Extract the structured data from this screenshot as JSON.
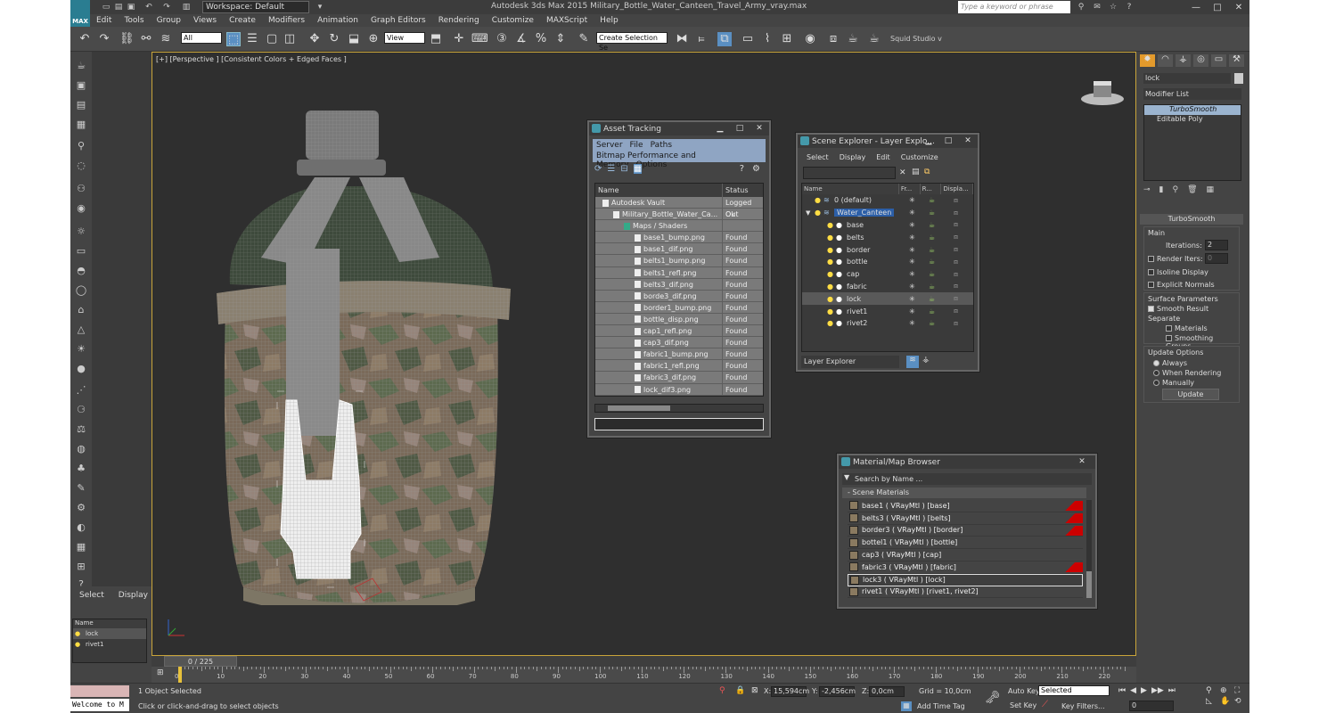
{
  "window": {
    "title": "Autodesk 3ds Max  2015      Military_Bottle_Water_Canteen_Travel_Army_vray.max",
    "workspace": "Workspace: Default",
    "search_placeholder": "Type a keyword or phrase",
    "logo": "MAX"
  },
  "menu": [
    "Edit",
    "Tools",
    "Group",
    "Views",
    "Create",
    "Modifiers",
    "Animation",
    "Graph Editors",
    "Rendering",
    "Customize",
    "MAXScript",
    "Help"
  ],
  "toolbar": {
    "filter": "All",
    "refcoord": "View",
    "selset": "Create Selection Se",
    "studio": "Squid Studio v"
  },
  "viewport": {
    "label": "[+] [Perspective ] [Consistent Colors + Edged Faces ]"
  },
  "asset_tracking": {
    "title": "Asset Tracking",
    "menu1": [
      "Server",
      "File",
      "Paths"
    ],
    "menu2": [
      "Bitmap Performance and Memory",
      "Options"
    ],
    "col_name": "Name",
    "col_status": "Status",
    "rows": [
      {
        "name": "Autodesk Vault",
        "status": "Logged Out",
        "indent": 0
      },
      {
        "name": "Military_Bottle_Water_Ca...",
        "status": "Ok",
        "indent": 1
      },
      {
        "name": "Maps / Shaders",
        "status": "",
        "indent": 2
      },
      {
        "name": "base1_bump.png",
        "status": "Found",
        "indent": 3
      },
      {
        "name": "base1_dif.png",
        "status": "Found",
        "indent": 3
      },
      {
        "name": "belts1_bump.png",
        "status": "Found",
        "indent": 3
      },
      {
        "name": "belts1_refl.png",
        "status": "Found",
        "indent": 3
      },
      {
        "name": "belts3_dif.png",
        "status": "Found",
        "indent": 3
      },
      {
        "name": "borde3_dif.png",
        "status": "Found",
        "indent": 3
      },
      {
        "name": "border1_bump.png",
        "status": "Found",
        "indent": 3
      },
      {
        "name": "bottle_disp.png",
        "status": "Found",
        "indent": 3
      },
      {
        "name": "cap1_refl.png",
        "status": "Found",
        "indent": 3
      },
      {
        "name": "cap3_dif.png",
        "status": "Found",
        "indent": 3
      },
      {
        "name": "fabric1_bump.png",
        "status": "Found",
        "indent": 3
      },
      {
        "name": "fabric1_refl.png",
        "status": "Found",
        "indent": 3
      },
      {
        "name": "fabric3_dif.png",
        "status": "Found",
        "indent": 3
      },
      {
        "name": "lock_dif3.png",
        "status": "Found",
        "indent": 3
      }
    ]
  },
  "scene_explorer": {
    "title": "Scene Explorer - Layer Explo...",
    "menu": [
      "Select",
      "Display",
      "Edit",
      "Customize"
    ],
    "cols": [
      "Name",
      "Fr...",
      "R...",
      "Displa..."
    ],
    "rows": [
      {
        "name": "0 (default)",
        "type": "layer"
      },
      {
        "name": "Water_Canteen",
        "type": "layer-selected"
      },
      {
        "name": "base",
        "type": "obj"
      },
      {
        "name": "belts",
        "type": "obj"
      },
      {
        "name": "border",
        "type": "obj"
      },
      {
        "name": "bottle",
        "type": "obj"
      },
      {
        "name": "cap",
        "type": "obj"
      },
      {
        "name": "fabric",
        "type": "obj"
      },
      {
        "name": "lock",
        "type": "obj-hl"
      },
      {
        "name": "rivet1",
        "type": "obj"
      },
      {
        "name": "rivet2",
        "type": "obj"
      }
    ],
    "footer": "Layer Explorer"
  },
  "material_browser": {
    "title": "Material/Map Browser",
    "search": "Search by Name ...",
    "group": "- Scene Materials",
    "rows": [
      {
        "name": "base1  ( VRayMtl )  [base]",
        "red": true
      },
      {
        "name": "belts3  ( VRayMtl )  [belts]",
        "red": true
      },
      {
        "name": "border3  ( VRayMtl )  [border]",
        "red": true
      },
      {
        "name": "bottel1  ( VRayMtl )  [bottle]",
        "red": false
      },
      {
        "name": "cap3  ( VRayMtl )  [cap]",
        "red": false
      },
      {
        "name": "fabric3  ( VRayMtl )  [fabric]",
        "red": true
      },
      {
        "name": "lock3  ( VRayMtl )  [lock]",
        "red": false,
        "sel": true
      },
      {
        "name": "rivet1  ( VRayMtl )  [rivet1, rivet2]",
        "red": false
      }
    ]
  },
  "command_panel": {
    "object_name": "lock",
    "modifier_list": "Modifier List",
    "stack": [
      "TurboSmooth",
      "Editable Poly"
    ],
    "rollout_title": "TurboSmooth",
    "main": "Main",
    "iterations_label": "Iterations:",
    "iterations": "2",
    "render_iters": "Render Iters:",
    "render_iters_val": "0",
    "isoline": "Isoline Display",
    "explicit": "Explicit Normals",
    "surface": "Surface Parameters",
    "smooth": "Smooth Result",
    "separate": "Separate",
    "materials": "Materials",
    "smoothing": "Smoothing Groups",
    "update_options": "Update Options",
    "always": "Always",
    "when_rendering": "When Rendering",
    "manually": "Manually",
    "update_btn": "Update"
  },
  "left_panel": {
    "tabs": [
      "Select",
      "Display"
    ],
    "name_col": "Name",
    "items": [
      "lock",
      "rivet1"
    ]
  },
  "timeline": {
    "frame": "0 / 225",
    "ticks": [
      "0",
      "10",
      "20",
      "30",
      "40",
      "50",
      "60",
      "70",
      "80",
      "90",
      "100",
      "110",
      "120",
      "130",
      "140",
      "150",
      "160",
      "170",
      "180",
      "190",
      "200",
      "210",
      "220"
    ]
  },
  "status": {
    "listener": "Welcome to M",
    "selected": "1 Object Selected",
    "prompt": "Click or click-and-drag to select objects",
    "x": "15,594cm",
    "y": "-2,456cm",
    "z": "0,0cm",
    "grid": "Grid = 10,0cm",
    "autokey": "Auto Key",
    "setkey": "Set Key",
    "keymode": "Selected",
    "keyfilters": "Key Filters...",
    "addtag": "Add Time Tag",
    "frame": "0",
    "x_lbl": "X:",
    "y_lbl": "Y:",
    "z_lbl": "Z:"
  }
}
